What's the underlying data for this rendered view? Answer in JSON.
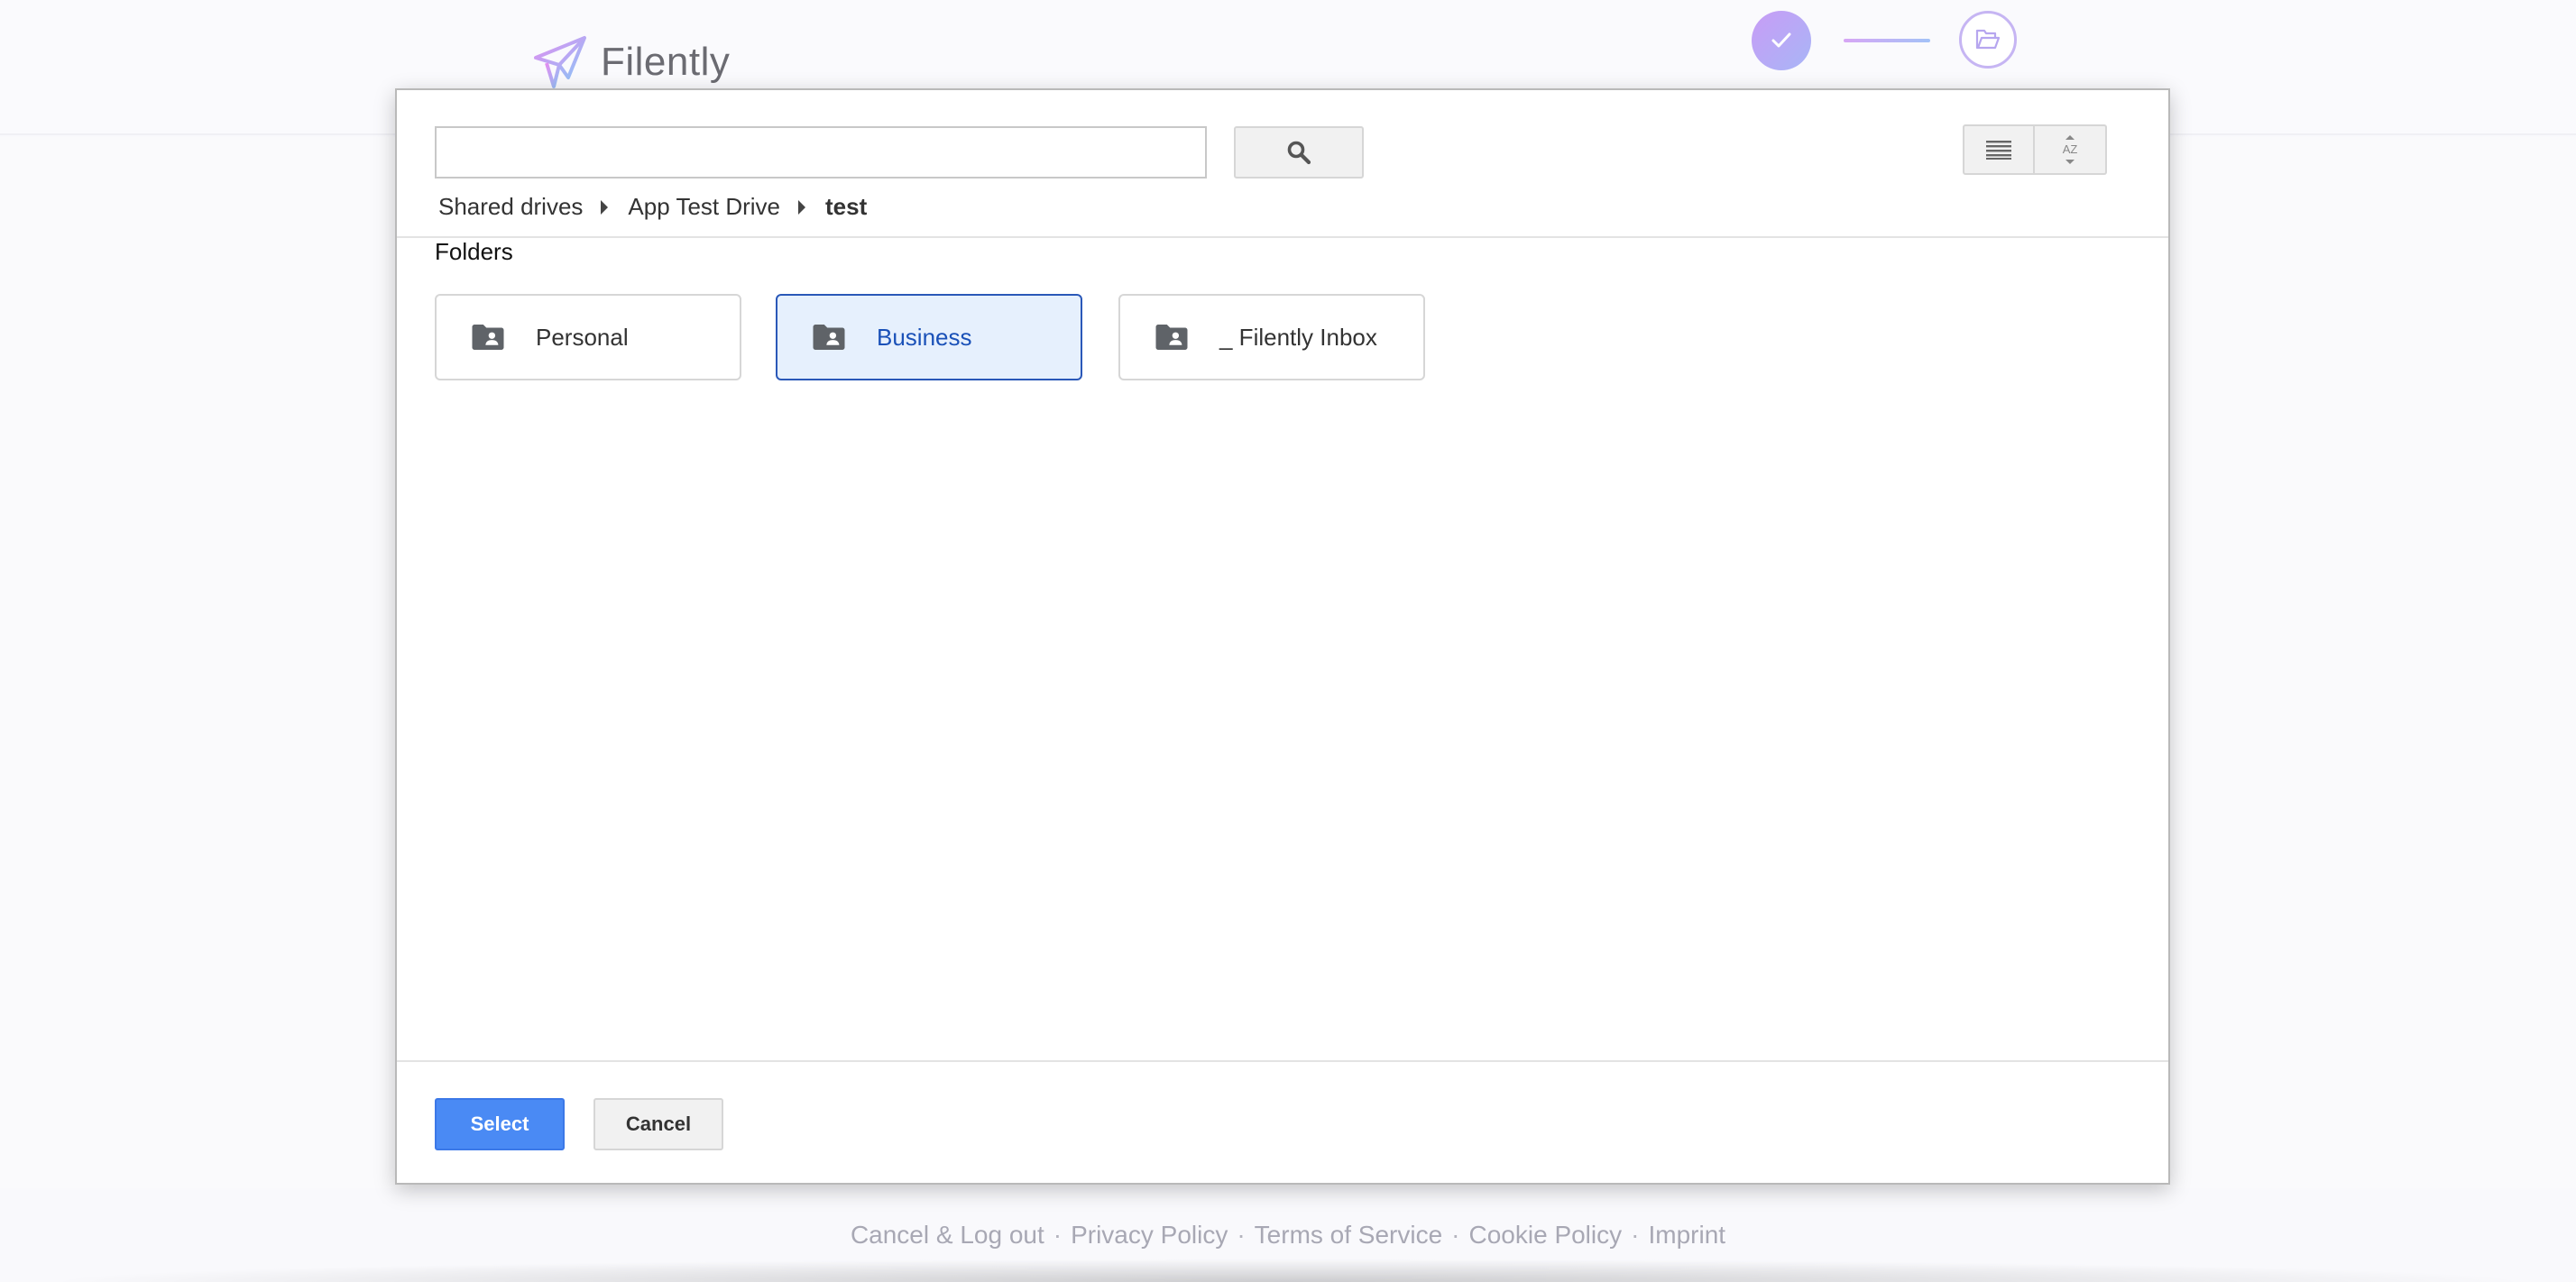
{
  "app": {
    "name": "Filently",
    "colors": {
      "brand_gradient_start": "#c89cf5",
      "brand_gradient_end": "#a8b6f7"
    }
  },
  "progress_steps": [
    {
      "state": "done",
      "icon": "check-icon"
    },
    {
      "state": "current",
      "icon": "folder-open-icon"
    }
  ],
  "picker": {
    "search": {
      "value": "",
      "placeholder": ""
    },
    "breadcrumb": [
      "Shared drives",
      "App Test Drive",
      "test"
    ],
    "section_label": "Folders",
    "folders": [
      {
        "name": "Personal",
        "icon": "shared-folder-icon",
        "selected": false
      },
      {
        "name": "Business",
        "icon": "shared-folder-icon",
        "selected": true
      },
      {
        "name": "_ Filently Inbox",
        "icon": "shared-folder-icon",
        "selected": false
      }
    ],
    "buttons": {
      "select": "Select",
      "cancel": "Cancel"
    },
    "colors": {
      "select_button": "#4a8af4",
      "selected_folder_bg": "#e6f0fd",
      "selected_folder_border": "#2a58b8"
    }
  },
  "footer": {
    "links": [
      "Cancel & Log out",
      "Privacy Policy",
      "Terms of Service",
      "Cookie Policy",
      "Imprint"
    ],
    "separator": "·"
  }
}
